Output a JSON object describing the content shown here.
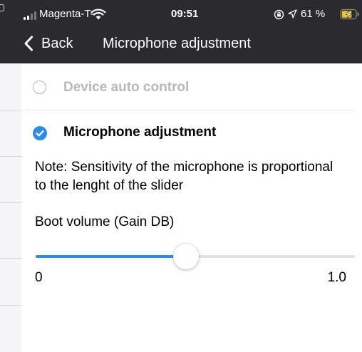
{
  "status_bar": {
    "carrier": "Magenta-T-",
    "time": "09:51",
    "battery_percent": "61 %",
    "icons": [
      "signal-icon",
      "wifi-icon",
      "orientation-lock-icon",
      "location-icon",
      "battery-charging-icon"
    ]
  },
  "nav": {
    "back_label": "Back",
    "title": "Microphone adjustment"
  },
  "options": [
    {
      "label": "Device auto control",
      "selected": false
    },
    {
      "label": "Microphone adjustment",
      "selected": true
    }
  ],
  "note": "Note: Sensitivity of the microphone is proportional to the lenght of the slider",
  "slider": {
    "label": "Boot volume (Gain DB)",
    "min_label": "0",
    "max_label": "1.0",
    "value_fraction": 0.47
  },
  "colors": {
    "accent": "#2f8ce5",
    "nav_background": "#2b2b2d",
    "disabled_text": "#b8b8b8"
  }
}
